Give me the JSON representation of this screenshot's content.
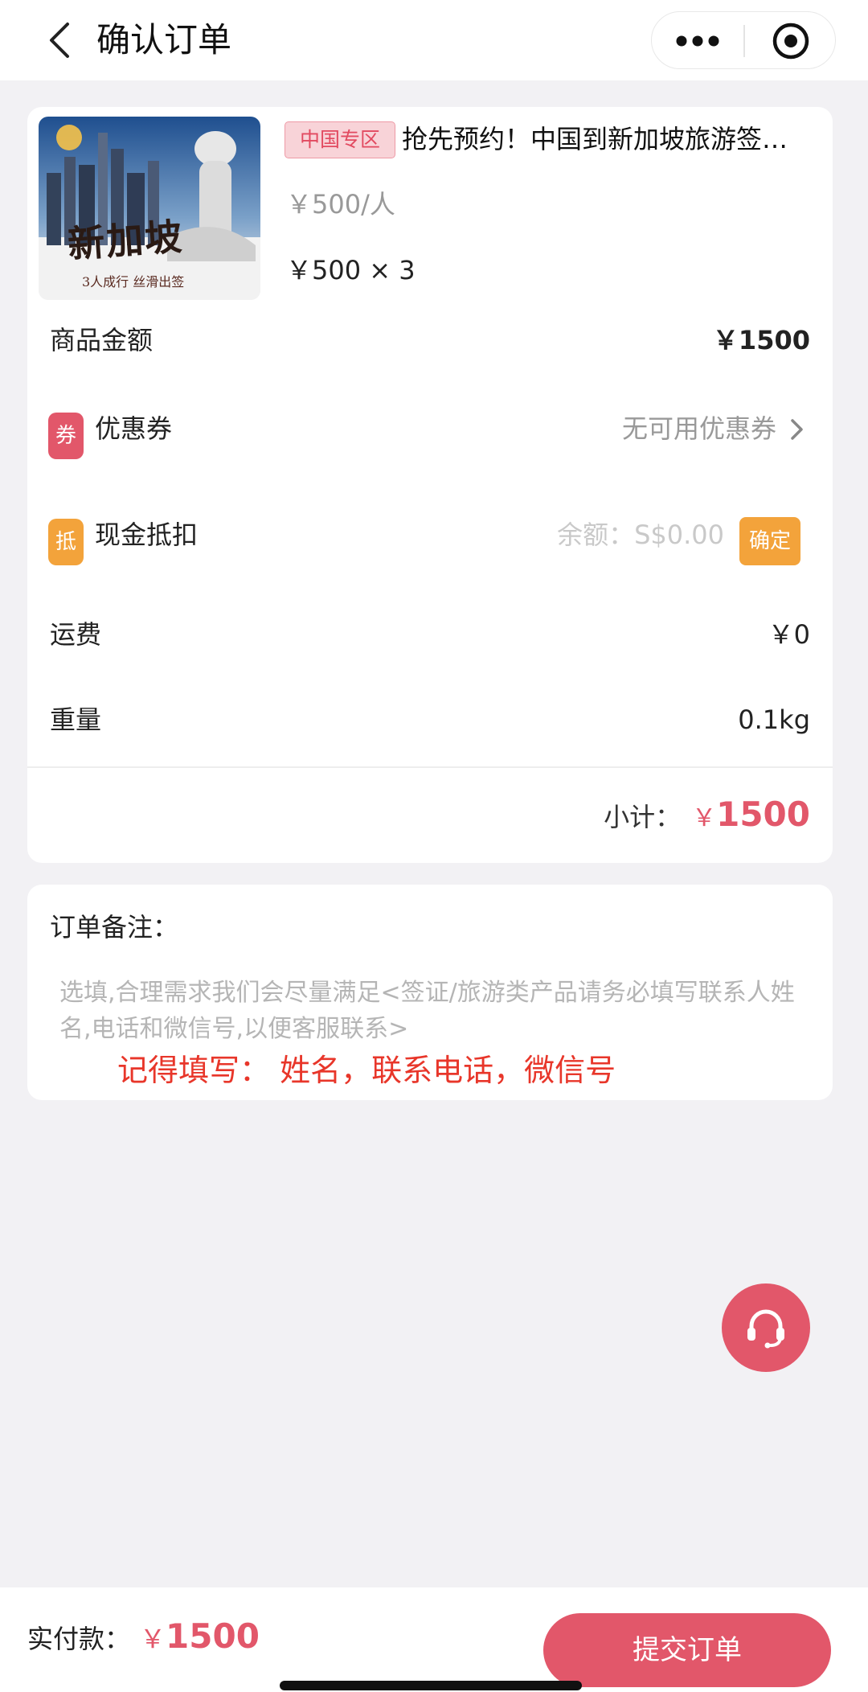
{
  "nav": {
    "title": "确认订单",
    "back_icon": "chevron-left-icon",
    "more_icon": "more-dots-icon",
    "home_icon": "target-circle-icon"
  },
  "product": {
    "thumb_text": "新加坡",
    "thumb_subtitle": "3人成行 丝滑出签",
    "tag": "中国专区",
    "title": "抢先预约！中国到新加坡旅游签…",
    "unit_price": "￥500/人",
    "qty_price": "￥500 × 3"
  },
  "order": {
    "goods_amount_label": "商品金额",
    "goods_amount_value": "￥1500",
    "coupon_icon_text": "券",
    "coupon_label": "优惠券",
    "coupon_value": "无可用优惠券",
    "cash_icon_text": "抵",
    "cash_label": "现金抵扣",
    "cash_balance": "余额：S$0.00",
    "cash_confirm": "确定",
    "shipping_label": "运费",
    "shipping_value": "￥0",
    "weight_label": "重量",
    "weight_value": "0.1kg",
    "subtotal_label": "小计：",
    "subtotal_currency": "￥",
    "subtotal_amount": "1500"
  },
  "remark": {
    "label": "订单备注：",
    "placeholder": "选填,合理需求我们会尽量满足<签证/旅游类产品请务必填写联系人姓名,电话和微信号,以便客服联系>",
    "hint": "记得填写： 姓名，联系电话，微信号"
  },
  "footer": {
    "pay_label": "实付款：",
    "pay_currency": "￥",
    "pay_amount": "1500",
    "submit_label": "提交订单"
  },
  "colors": {
    "accent": "#e2576a",
    "coupon_icon": "#e2576a",
    "cash_icon": "#f3a33b",
    "hint": "#e8362a"
  }
}
